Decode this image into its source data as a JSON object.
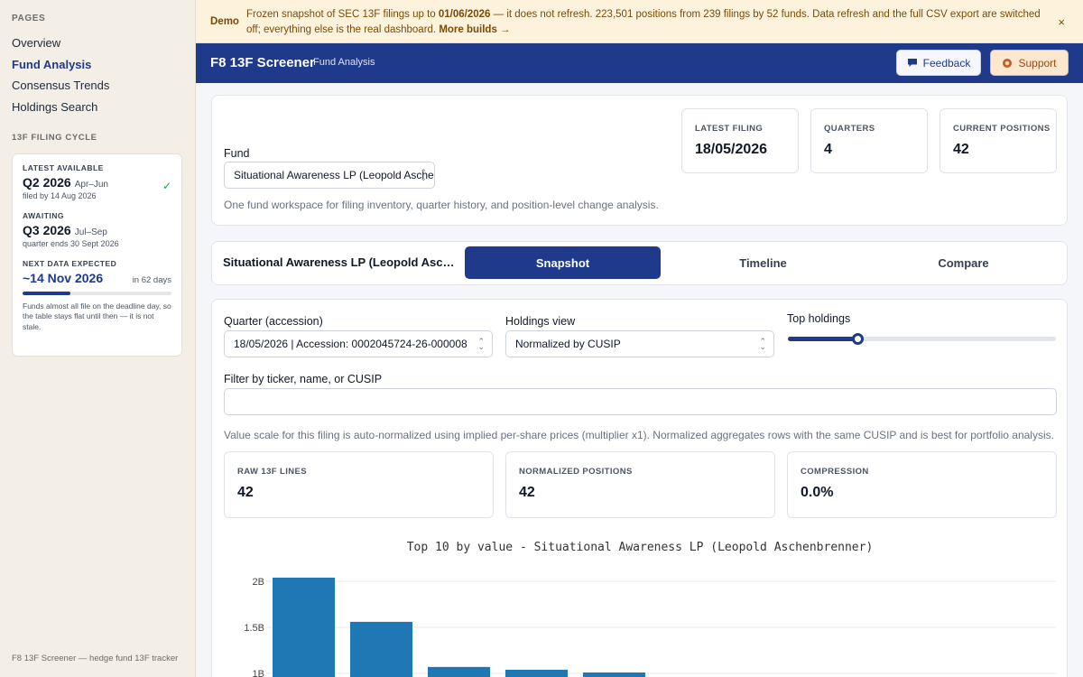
{
  "sidebar": {
    "pages_heading": "PAGES",
    "nav": [
      {
        "label": "Overview",
        "active": false
      },
      {
        "label": "Fund Analysis",
        "active": true
      },
      {
        "label": "Consensus Trends",
        "active": false
      },
      {
        "label": "Holdings Search",
        "active": false
      }
    ],
    "cycle_heading": "13F FILING CYCLE",
    "cycle": {
      "latest_label": "LATEST AVAILABLE",
      "latest_quarter": "Q2 2026",
      "latest_months": "Apr–Jun",
      "latest_sub": "filed by 14 Aug 2026",
      "awaiting_label": "AWAITING",
      "awaiting_quarter": "Q3 2026",
      "awaiting_months": "Jul–Sep",
      "awaiting_sub": "quarter ends 30 Sept 2026",
      "next_label": "NEXT DATA EXPECTED",
      "next_date": "~14 Nov 2026",
      "next_days": "in 62 days",
      "progress_fraction": 0.32,
      "note": "Funds almost all file on the deadline day, so the table stays flat until then — it is not stale."
    },
    "footer": "F8 13F Screener — hedge fund 13F tracker"
  },
  "banner": {
    "tag": "Demo",
    "text_pre": "Frozen snapshot of SEC 13F filings up to ",
    "text_date": "01/06/2026",
    "text_post": " — it does not refresh. 223,501 positions from 239 filings by 52 funds. Data refresh and the full CSV export are switched off; everything else is the real dashboard. ",
    "link": "More builds →",
    "close": "×"
  },
  "topbar": {
    "title": "F8 13F Screener",
    "subtitle": "Fund Analysis",
    "feedback_label": "Feedback",
    "support_label": "Support"
  },
  "fund_panel": {
    "fund_label": "Fund",
    "fund_value": "Situational Awareness LP (Leopold Aschenbrenner)",
    "help": "One fund workspace for filing inventory, quarter history, and position-level change analysis.",
    "stats": [
      {
        "label": "LATEST FILING",
        "value": "18/05/2026"
      },
      {
        "label": "QUARTERS",
        "value": "4"
      },
      {
        "label": "CURRENT POSITIONS",
        "value": "42"
      }
    ]
  },
  "tabs": {
    "fund_name": "Situational Awareness LP (Leopold Aschenbrenner)",
    "items": [
      {
        "label": "Snapshot",
        "active": true
      },
      {
        "label": "Timeline",
        "active": false
      },
      {
        "label": "Compare",
        "active": false
      }
    ]
  },
  "snapshot": {
    "quarter_label": "Quarter (accession)",
    "quarter_value": "18/05/2026 | Accession: 0002045724-26-000008",
    "view_label": "Holdings view",
    "view_value": "Normalized by CUSIP",
    "top_label": "Top holdings",
    "top_fraction": 0.26,
    "filter_label": "Filter by ticker, name, or CUSIP",
    "filter_value": "",
    "help": "Value scale for this filing is auto-normalized using implied per-share prices (multiplier x1). Normalized aggregates rows with the same CUSIP and is best for portfolio analysis.",
    "stats": [
      {
        "label": "RAW 13F LINES",
        "value": "42"
      },
      {
        "label": "NORMALIZED POSITIONS",
        "value": "42"
      },
      {
        "label": "COMPRESSION",
        "value": "0.0%"
      }
    ]
  },
  "chart_data": {
    "type": "bar",
    "title": "Top 10 by value - Situational Awareness LP (Leopold Aschenbrenner)",
    "y_ticks": [
      {
        "value": 1000000000,
        "label": "1B"
      },
      {
        "value": 1500000000,
        "label": "1.5B"
      },
      {
        "value": 2000000000,
        "label": "2B"
      }
    ],
    "values": [
      2040000000,
      1560000000,
      1070000000,
      1040000000,
      1010000000
    ],
    "bar_color": "#1f77b4"
  }
}
